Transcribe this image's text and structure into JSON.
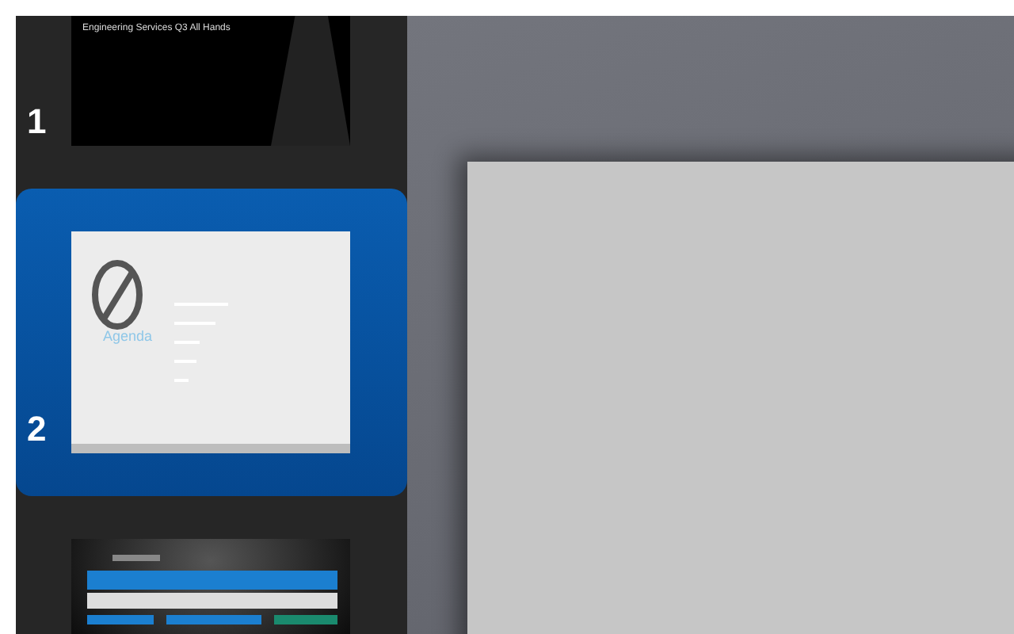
{
  "slides": [
    {
      "number": "1",
      "selected": false,
      "kind": "title",
      "title": "Engineering Services Q3 All Hands"
    },
    {
      "number": "2",
      "selected": true,
      "kind": "agenda",
      "title": "Agenda"
    },
    {
      "selected": false,
      "kind": "dashboard"
    }
  ]
}
